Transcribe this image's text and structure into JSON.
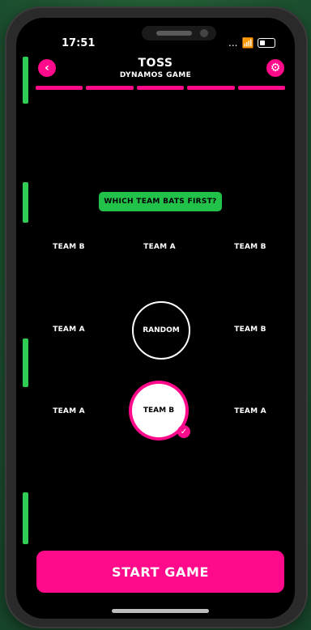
{
  "status_bar": {
    "time": "17:51",
    "signal_text": "...",
    "wifi_icon": "wifi-icon",
    "battery_icon": "battery-icon"
  },
  "header": {
    "title": "TOSS",
    "subtitle": "DYNAMOS GAME",
    "back_icon": "chevron-left-icon",
    "settings_icon": "gear-icon",
    "progress_segments": 5
  },
  "question": "WHICH TEAM BATS FIRST?",
  "rows": {
    "row1": [
      "TEAM B",
      "TEAM A",
      "TEAM B"
    ],
    "row2": [
      "TEAM A",
      "RANDOM",
      "TEAM B"
    ],
    "row3": [
      "TEAM A",
      "TEAM B",
      "TEAM A"
    ]
  },
  "selected": "TEAM B",
  "actions": {
    "start": "START GAME"
  },
  "colors": {
    "accent": "#ff0a8a",
    "question_bg": "#22c24a",
    "background": "#000000"
  }
}
